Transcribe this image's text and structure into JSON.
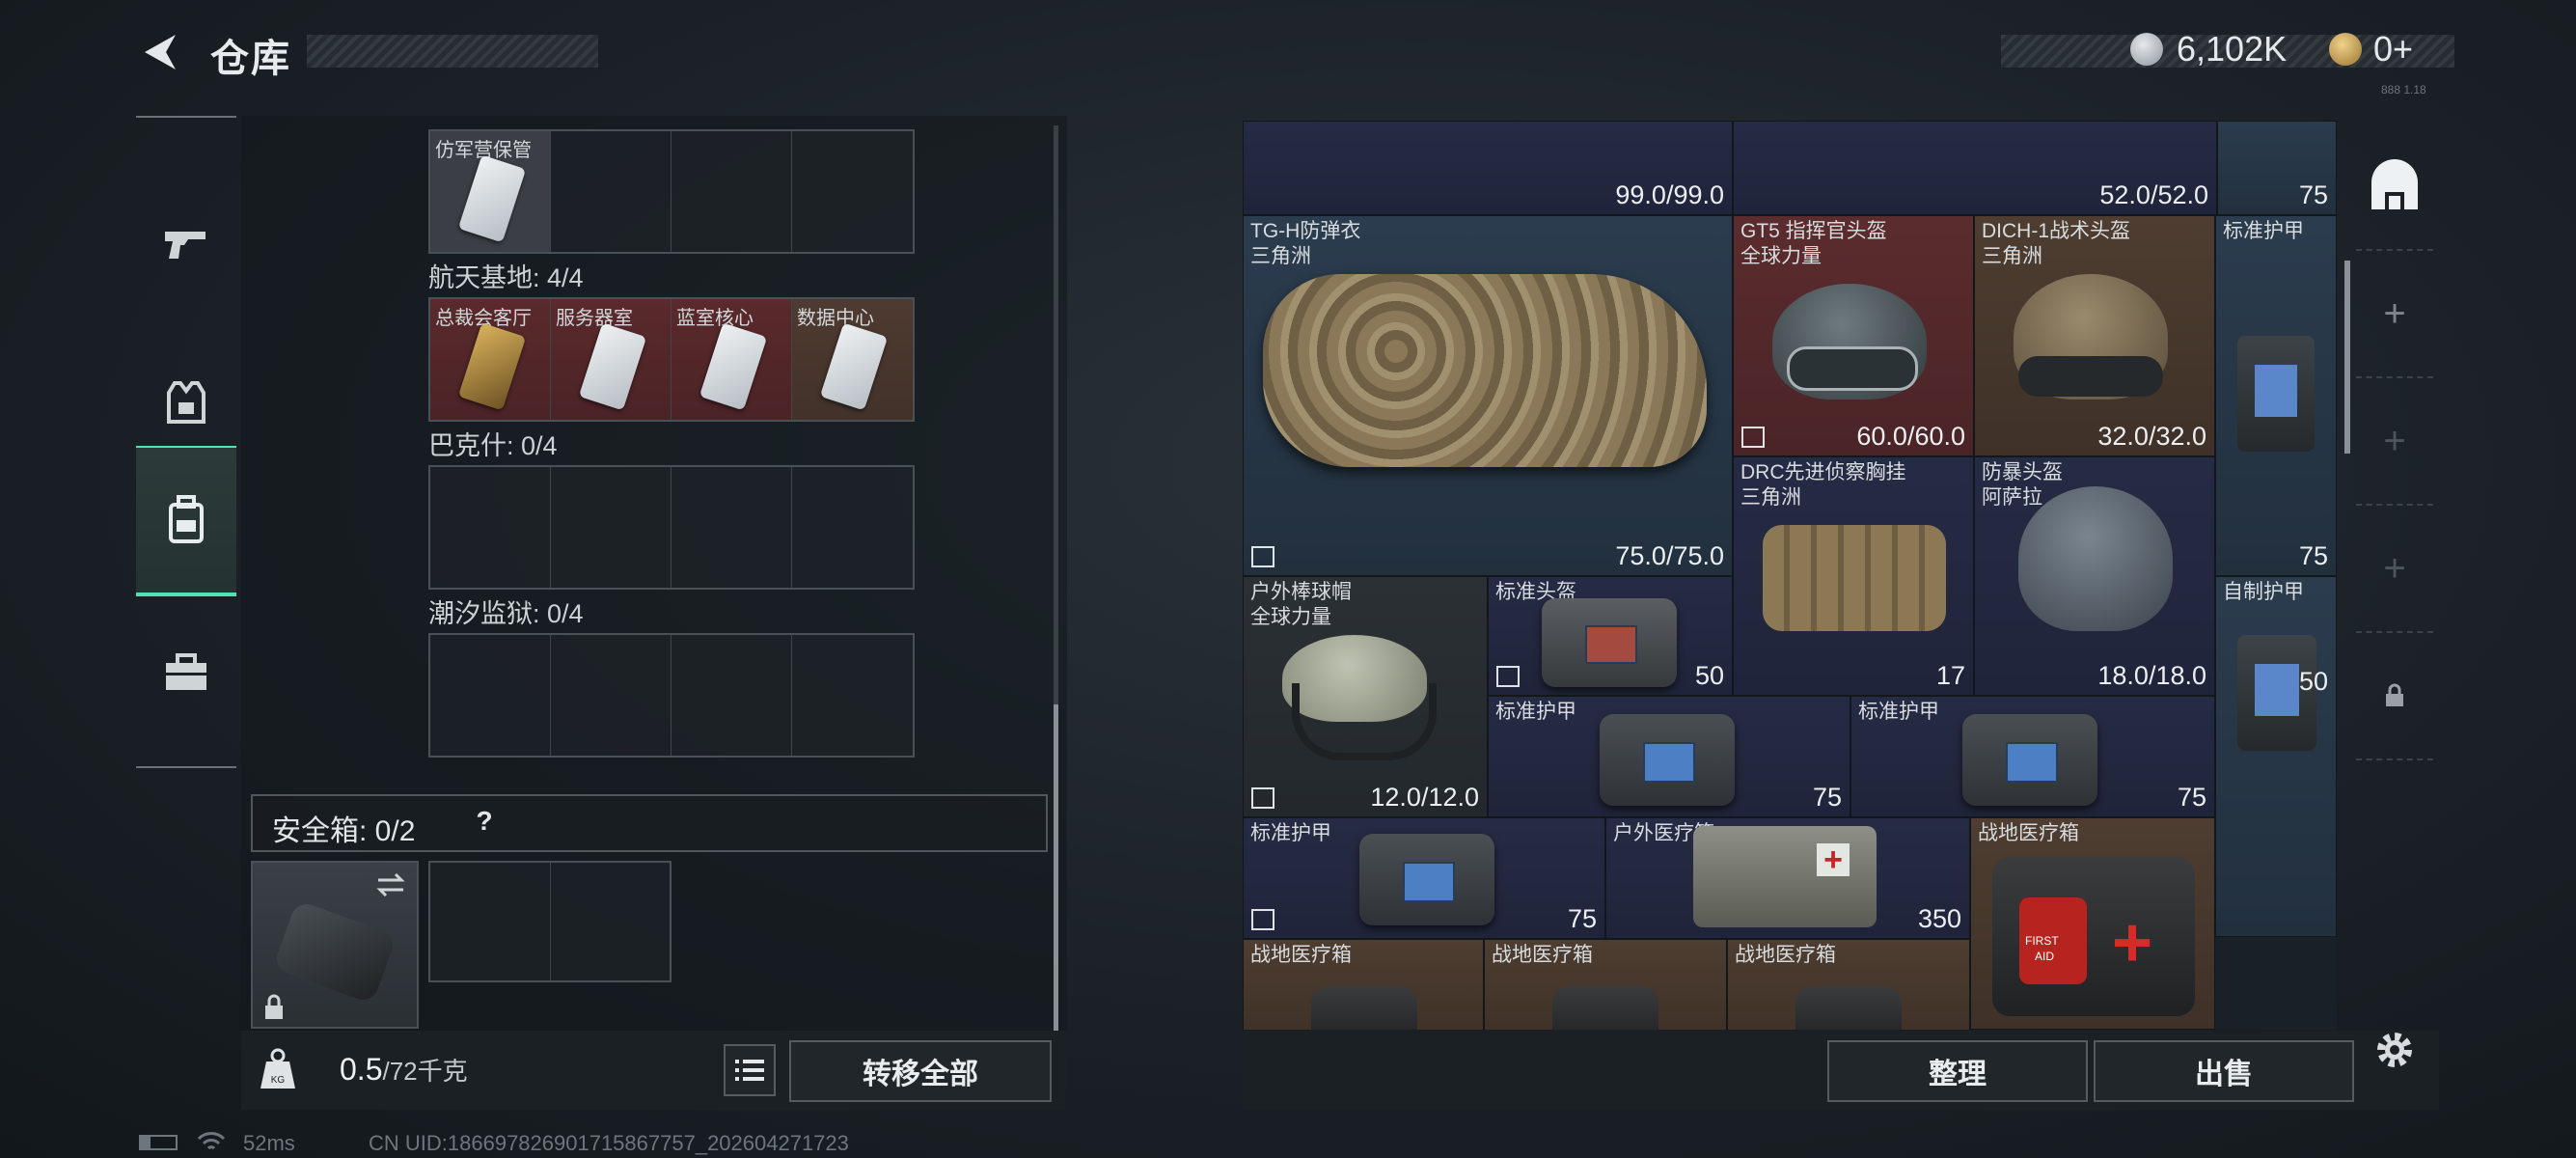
{
  "header": {
    "title": "仓库",
    "currency_1": "6,102K",
    "currency_2": "0+",
    "small_label": "888 1.18"
  },
  "left": {
    "top_row_label": "仿军营保管",
    "sections": [
      {
        "label": "航天基地: 4/4",
        "cells": [
          "总裁会客厅",
          "服务器室",
          "蓝室核心",
          "数据中心"
        ]
      },
      {
        "label": "巴克什: 0/4"
      },
      {
        "label": "潮汐监狱: 0/4"
      }
    ],
    "safe_box_label": "安全箱: 0/2",
    "safe_box_help": "?",
    "weight_value": "0.5",
    "weight_total": "/72千克",
    "weight_icon_text": "KG",
    "transfer_all": "转移全部"
  },
  "right": {
    "row0": [
      "99.0/99.0",
      "52.0/52.0",
      "75"
    ],
    "items": {
      "vest_name": "TG-H防弹衣",
      "vest_sub": "三角洲",
      "vest_val": "75.0/75.0",
      "gt5_name": "GT5 指挥官头盔",
      "gt5_sub": "全球力量",
      "gt5_val": "60.0/60.0",
      "dich_name": "DICH-1战术头盔",
      "dich_sub": "三角洲",
      "dich_val": "32.0/32.0",
      "std_armor": "标准护甲",
      "val_75": "75",
      "drc_name": "DRC先进侦察胸挂",
      "drc_sub": "三角洲",
      "drc_val": "17",
      "riot_name": "防暴头盔",
      "riot_sub": "阿萨拉",
      "riot_val": "18.0/18.0",
      "cap_name": "户外棒球帽",
      "cap_sub": "全球力量",
      "cap_val": "12.0/12.0",
      "std_helmet": "标准头盔",
      "val_50": "50",
      "self_armor": "自制护甲",
      "outdoor_med": "户外医疗箱",
      "outdoor_med_val": "350",
      "field_med": "战地医疗箱",
      "first_aid_1": "FIRST",
      "first_aid_2": "AID"
    },
    "sort_button": "整理",
    "sell_button": "出售"
  },
  "status": {
    "ping": "52ms",
    "uid": "CN UID:18669782690171586775​7_202604271723"
  }
}
